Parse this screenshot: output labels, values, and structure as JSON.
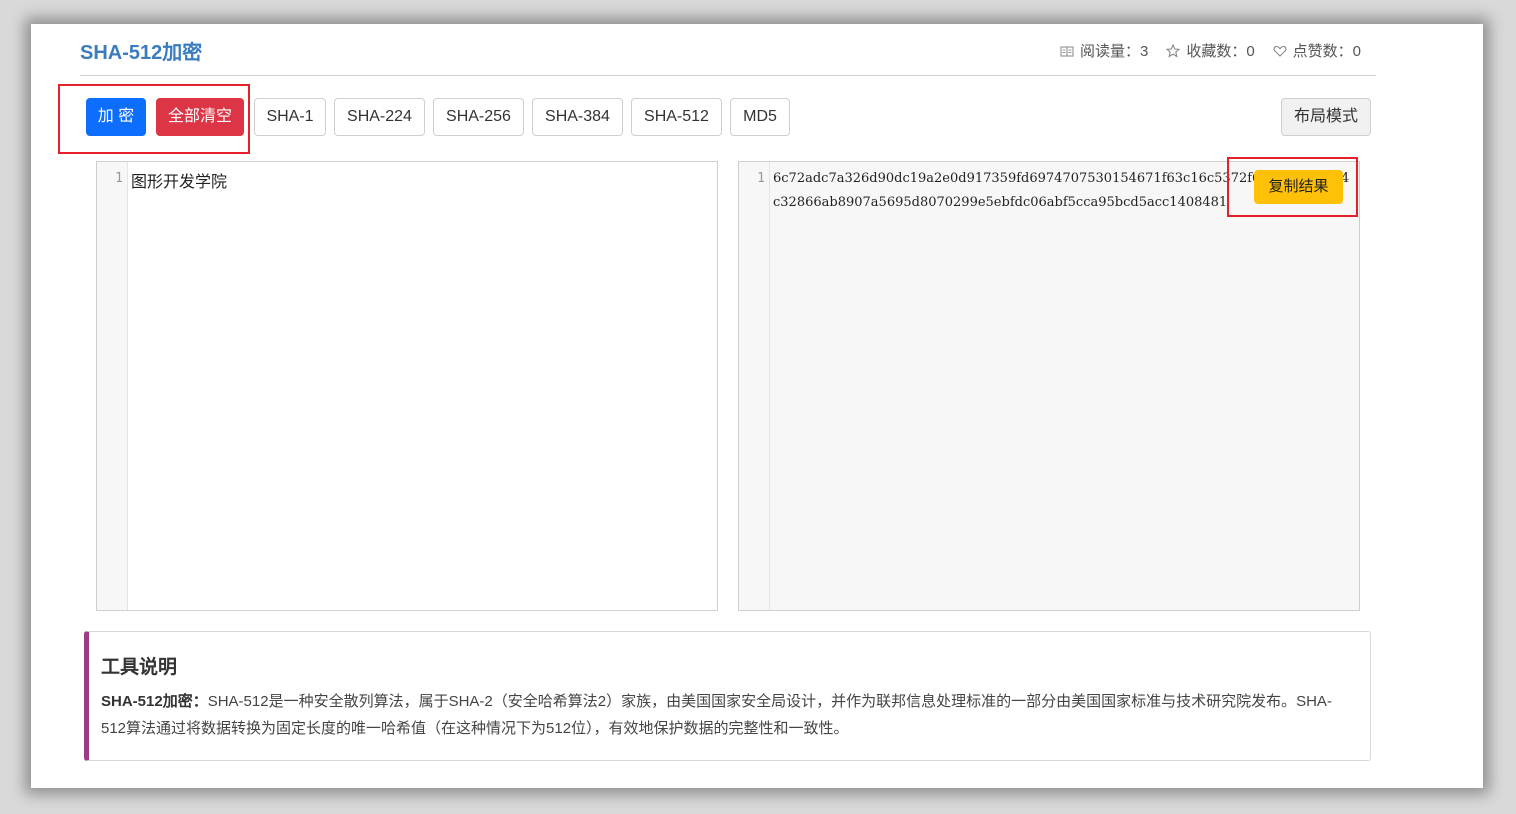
{
  "header": {
    "title": "SHA-512加密",
    "stats": [
      {
        "icon": "book-icon",
        "label": "阅读量：3"
      },
      {
        "icon": "star-icon",
        "label": "收藏数：0"
      },
      {
        "icon": "heart-icon",
        "label": "点赞数：0"
      }
    ]
  },
  "toolbar": {
    "encrypt_label": "加 密",
    "clear_label": "全部清空",
    "algorithms": [
      "SHA-1",
      "SHA-224",
      "SHA-256",
      "SHA-384",
      "SHA-512",
      "MD5"
    ],
    "layout_label": "布局模式"
  },
  "input_editor": {
    "line_number": "1",
    "value": "图形开发学院"
  },
  "output_editor": {
    "line_number": "1",
    "value": "6c72adc7a326d90dc19a2e0d917359fd6974707530154671f63c16c5372f6872cea8d154c32866ab8907a5695d8070299e5ebfdc06abf5cca95bcd5acc1408481",
    "copy_label": "复制结果"
  },
  "description": {
    "heading": "工具说明",
    "term": "SHA-512加密：",
    "text": "SHA-512是一种安全散列算法，属于SHA-2（安全哈希算法2）家族，由美国国家安全局设计，并作为联邦信息处理标准的一部分由美国国家标准与技术研究院发布。SHA-512算法通过将数据转换为固定长度的唯一哈希值（在这种情况下为512位），有效地保护数据的完整性和一致性。"
  },
  "colors": {
    "title": "#3a7cc0",
    "primary": "#0d6efd",
    "danger": "#dc3545",
    "warning": "#ffc107",
    "accent_border": "#9b3d86",
    "highlight_box": "#e5202a"
  }
}
